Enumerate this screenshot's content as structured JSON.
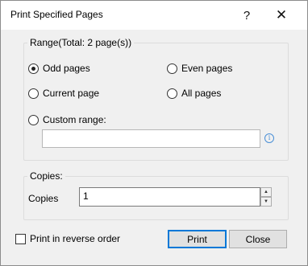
{
  "window": {
    "title": "Print Specified Pages",
    "help_glyph": "?",
    "close_glyph": "✕"
  },
  "range": {
    "group_label": "Range(Total: 2 page(s))",
    "options": [
      {
        "label": "Odd pages",
        "checked": true
      },
      {
        "label": "Even pages",
        "checked": false
      },
      {
        "label": "Current page",
        "checked": false
      },
      {
        "label": "All pages",
        "checked": false
      },
      {
        "label": "Custom range:",
        "checked": false
      }
    ],
    "custom_range_value": "",
    "info_glyph": "i"
  },
  "copies": {
    "group_label": "Copies:",
    "label": "Copies",
    "value": "1",
    "up_glyph": "▲",
    "down_glyph": "▼"
  },
  "reverse_order": {
    "label": "Print in reverse order",
    "checked": false
  },
  "buttons": {
    "print": "Print",
    "close": "Close"
  },
  "colors": {
    "accent": "#0078d7",
    "info": "#4a8fd6",
    "dialog_bg": "#f0f0f0"
  }
}
